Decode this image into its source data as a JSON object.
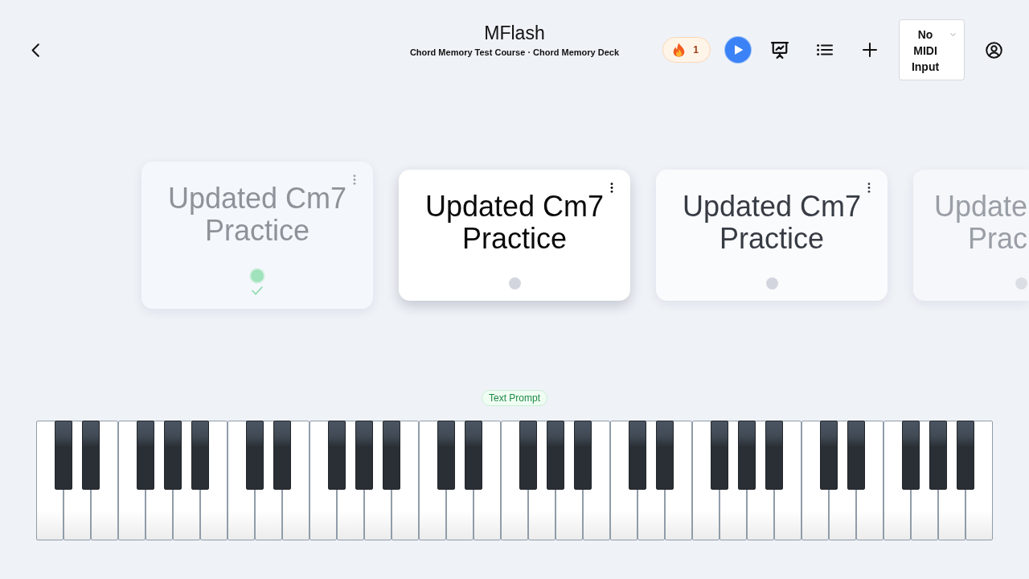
{
  "header": {
    "title": "MFlash",
    "subtitle": "Chord Memory Test Course · Chord Memory Deck"
  },
  "toolbar": {
    "streak": "1",
    "midi_input": {
      "value": "No MIDI Input"
    }
  },
  "cards": [
    {
      "title": "Updated Cm7 Practice",
      "selected": false,
      "completed": true,
      "cut_off": false
    },
    {
      "title": "Updated Cm7 Practice",
      "selected": true,
      "completed": false,
      "cut_off": false
    },
    {
      "title": "Updated Cm7 Practice",
      "selected": false,
      "completed": false,
      "cut_off": false
    },
    {
      "title": "Update Prac",
      "selected": false,
      "completed": false,
      "cut_off": true
    }
  ],
  "prompt_type": "Text Prompt"
}
